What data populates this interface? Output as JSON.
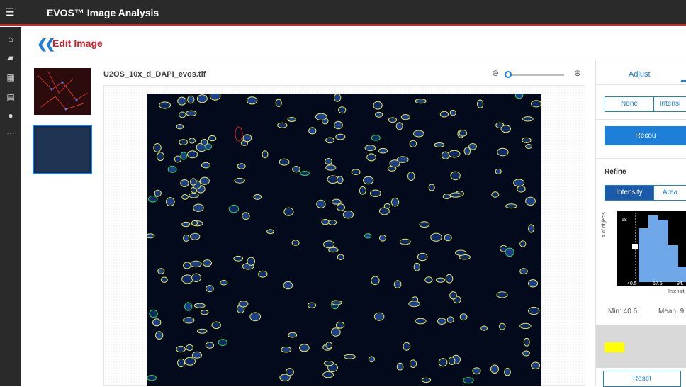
{
  "app": {
    "title": "EVOS™ Image Analysis",
    "menu_icon": "hamburger-icon"
  },
  "sidebar": {
    "icons": [
      "home-icon",
      "folder-icon",
      "apps-grid-icon",
      "save-icon",
      "users-icon",
      "more-icon"
    ]
  },
  "header": {
    "back_icon": "double-chevron-left-icon",
    "title": "Edit Image"
  },
  "file": {
    "name": "U2OS_10x_d_DAPI_evos.tif"
  },
  "zoom": {
    "out_icon": "zoom-out-icon",
    "in_icon": "zoom-in-icon",
    "level": 0
  },
  "panel": {
    "tab_adjust": "Adjust",
    "mode_buttons": [
      "None",
      "Intensi"
    ],
    "recount_label": "Recou",
    "refine_label": "Refine",
    "refine_tabs": [
      "Intensity",
      "Area"
    ],
    "hist_ytick": "68",
    "hist_xticks": [
      "40.5",
      "67.5",
      "94."
    ],
    "hist_ylabel": "# of objects",
    "hist_xlabel": "Intensit",
    "min_text": "Min: 40.6",
    "mean_text": "Mean: 9",
    "highlight_color": "#ffff00",
    "reset_label": "Reset"
  },
  "colors": {
    "accent": "#1e7fd8",
    "brand_red": "#d4202c",
    "topbar": "#2a2a2a"
  }
}
